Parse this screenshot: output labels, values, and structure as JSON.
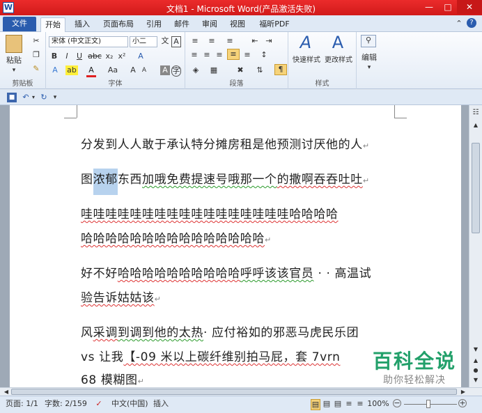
{
  "window": {
    "title": "文档1 - Microsoft Word(产品激活失败)",
    "app_icon": "W"
  },
  "tabs": [
    "文件",
    "开始",
    "插入",
    "页面布局",
    "引用",
    "邮件",
    "审阅",
    "视图",
    "福昕PDF"
  ],
  "ribbon": {
    "clipboard": {
      "label": "剪贴板",
      "paste": "粘贴"
    },
    "font": {
      "label": "字体",
      "font_name": "宋体 (中文正文)",
      "font_size": "小二"
    },
    "paragraph": {
      "label": "段落"
    },
    "styles": {
      "label": "样式",
      "quick_styles": "快速样式",
      "change_styles": "更改样式"
    },
    "editing": {
      "label": "编辑",
      "edit": "编辑"
    }
  },
  "document": {
    "line1": "分发到人人敢于承认特分摊房租是他预测讨厌他的人",
    "line2_before": "图",
    "line2_selected": "浓郁",
    "line2_after1": "东西",
    "line2_after2": "加哦免费提速号哦那一个",
    "line2_after3": "的撒啊吞吞吐吐",
    "line3": "哇哇哇哇哇哇哇哇哇哇哇哇哇哇哇哇哇哈哈哈哈",
    "line4": "哈哈哈哈哈哈哈哈哈哈哈哈哈哈哈",
    "line5a": "好不好",
    "line5b": "哈哈哈哈哈哈哈哈哈哈",
    "line5c": "呼呼该该官员",
    "line5d": "· · 高温试",
    "line6": "验告诉姑姑该",
    "line7a": "风",
    "line7b": "采调",
    "line7c": "到调到他的太热",
    "line7d": "· 应付裕如的邪恶马虎民乐团",
    "line8a": "vs 让我",
    "line8b": "【-09 米以上碳纤维别拍马屁，套 7vrn",
    "line9": "68 模糊图"
  },
  "watermark": {
    "title": "百科全说",
    "subtitle": "助你轻松解决"
  },
  "status": {
    "page": "页面: 1/1",
    "words": "字数: 2/159",
    "language": "中文(中国)",
    "mode": "插入",
    "zoom": "100%"
  }
}
